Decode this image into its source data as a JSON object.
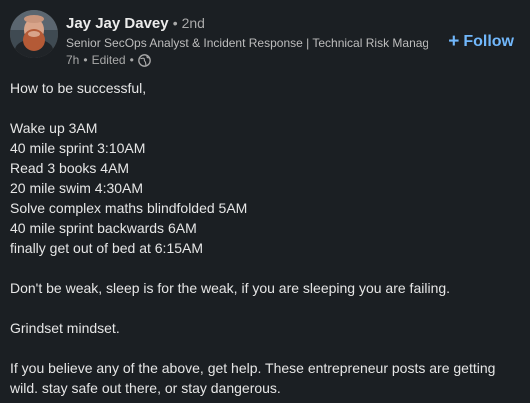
{
  "author": {
    "name": "Jay Jay Davey",
    "degree": "2nd",
    "headline": "Senior SecOps Analyst & Incident Response | Technical Risk Manag...",
    "time": "7h",
    "edited": "Edited",
    "visibility_icon": "globe-icon"
  },
  "follow": {
    "label": "Follow",
    "icon": "plus-icon"
  },
  "post": {
    "intro": "How to be successful,",
    "schedule": [
      "Wake up 3AM",
      "40 mile sprint 3:10AM",
      "Read 3 books 4AM",
      "20 mile swim 4:30AM",
      "Solve complex maths blindfolded 5AM",
      "40 mile sprint backwards 6AM",
      "finally get out of bed at 6:15AM"
    ],
    "weak": "Don't be weak, sleep is for the weak, if you are sleeping you are failing.",
    "grindset": "Grindset mindset.",
    "closing": "If you believe any of the above, get help. These entrepreneur posts are getting wild. stay safe out there, or stay dangerous."
  }
}
